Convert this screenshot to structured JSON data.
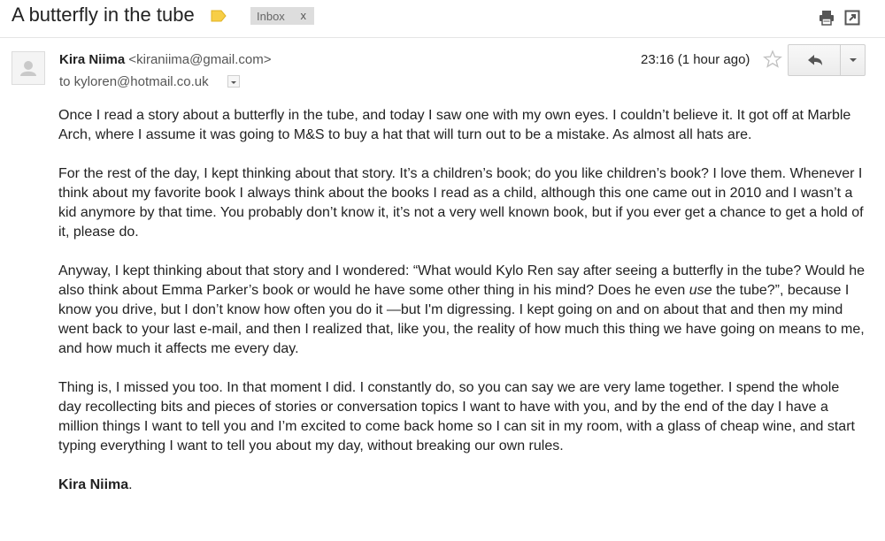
{
  "email": {
    "subject": "A butterfly in the tube",
    "label_chip": "Inbox",
    "label_chip_close": "x",
    "sender_name": "Kira Niima",
    "sender_email": "<kiraniima@gmail.com>",
    "to_line": "to kyloren@hotmail.co.uk",
    "time": "23:16 (1 hour ago)",
    "body": {
      "p1": "Once I read a story about a butterfly in the tube, and today I saw one with my own eyes. I couldn’t believe it. It got off at Marble Arch, where I assume it was going to M&S to buy a hat that will turn out to be a mistake. As almost all hats are.",
      "p2": "For the rest of the day, I kept thinking about that story. It’s a children’s book; do you like children’s book? I love them. Whenever I think about my favorite book I always think about the books I read as a child, although this one came out in 2010 and I wasn’t a kid anymore by that time. You probably don’t know it, it’s not a very well known book, but if you ever get a chance to get a hold of it, please do.",
      "p3_a": "Anyway, I kept thinking about that story and I wondered: “What would Kylo Ren say after seeing a butterfly in the tube? Would he also think about Emma Parker’s book or would he have some other thing in his mind? Does he even ",
      "p3_em": "use",
      "p3_b": " the tube?”, because I know you drive, but I don’t know how often you do it —but I'm digressing. I kept going on and on about that and then my mind went back to your last e-mail, and then I realized that, like you, the reality of how much this thing we have going on means to me, and how much it affects me every day.",
      "p4": "Thing is, I missed you too. In that moment I did. I constantly do, so you can say we are very lame together. I spend the whole day recollecting bits and pieces of stories or conversation topics I want to have with you, and by the end of the day I have a million things I want to tell you and I’m excited to come back home so I can sit in my room, with a glass of cheap wine, and start typing everything I want to tell you about my day, without breaking our own rules.",
      "signature": "Kira Niima",
      "signature_suffix": "."
    }
  },
  "icons": {
    "label_tag": "label-tag-icon",
    "print": "print-icon",
    "new_window": "new-window-icon",
    "avatar": "avatar-icon",
    "dropdown": "dropdown-icon",
    "star": "star-icon",
    "reply": "reply-icon",
    "more": "more-options-icon"
  },
  "colors": {
    "label_tag": "#f7ce46",
    "chip_bg": "#dddddd",
    "text": "#222222",
    "muted": "#555555"
  }
}
